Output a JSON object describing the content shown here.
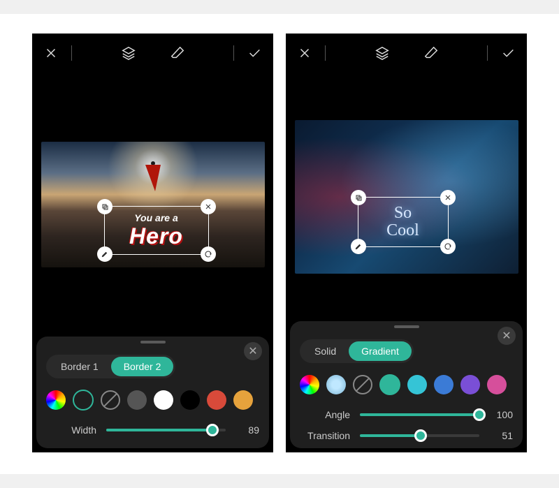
{
  "left": {
    "text": {
      "line1": "You are a",
      "line2": "Hero"
    },
    "tabs": [
      {
        "label": "Border 1",
        "active": false
      },
      {
        "label": "Border 2",
        "active": true
      }
    ],
    "colors": [
      "#555555",
      "#ffffff",
      "#000000",
      "#d84a3a",
      "#e6a23c",
      "#f2d94e",
      "#4caf50"
    ],
    "slider": {
      "label": "Width",
      "value": 89
    }
  },
  "right": {
    "text": {
      "line1": "So",
      "line2": "Cool"
    },
    "tabs": [
      {
        "label": "Solid",
        "active": false
      },
      {
        "label": "Gradient",
        "active": true
      }
    ],
    "colors": [
      "#2fb69a",
      "#35c4d6",
      "#3b7bd6",
      "#7a4fd6",
      "#d64f9b",
      "#d64f4f",
      "#e6a23c"
    ],
    "sliders": [
      {
        "label": "Angle",
        "value": 100
      },
      {
        "label": "Transition",
        "value": 51
      }
    ]
  }
}
